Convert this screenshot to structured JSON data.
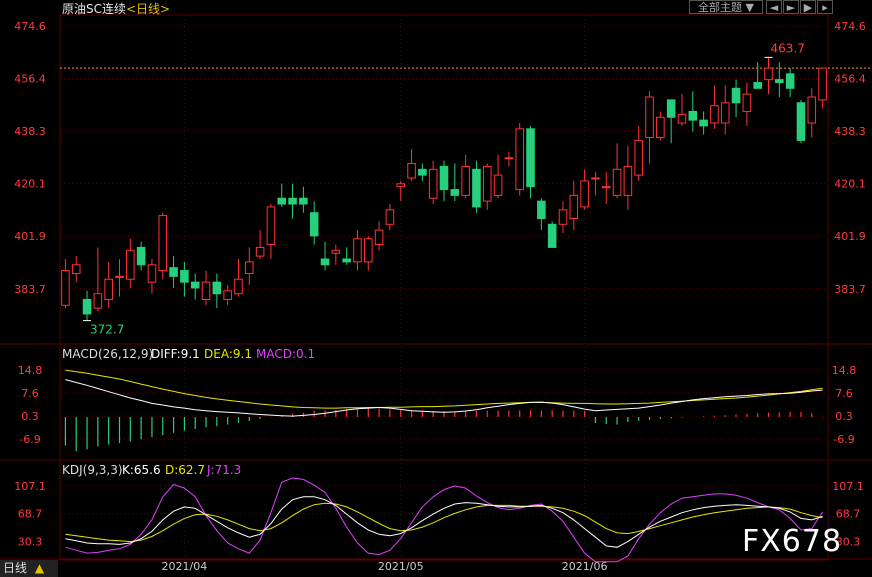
{
  "header": {
    "title": "原油SC连续",
    "period_link": "<日线>",
    "theme_button": "全部主题",
    "dropdown_icon": "triangle-down-icon",
    "nav_prev_icon": "step-left-icon",
    "nav_next_icon": "step-right-icon",
    "nav_end_icon": "triangle-right-icon"
  },
  "colors": {
    "up": "#ff3232",
    "down": "#26d07c",
    "diff": "#ffffff",
    "dea": "#e6e600",
    "macd_k": "#ffffff",
    "kdj_d": "#e6e600",
    "kdj_j": "#e040fb",
    "grid": "#5a0000"
  },
  "chart_data": [
    {
      "type": "candlestick",
      "ylim": [
        366,
        478
      ],
      "y_ticks": [
        "474.6",
        "456.4",
        "438.3",
        "420.1",
        "401.9",
        "383.7"
      ],
      "high_label": "463.7",
      "low_label": "372.7",
      "reference_line": 460,
      "candles": [
        [
          378,
          390,
          394,
          377
        ],
        [
          389,
          392,
          395,
          386
        ],
        [
          380,
          375,
          383,
          372.7
        ],
        [
          377,
          382,
          398,
          376
        ],
        [
          380,
          387,
          393,
          377
        ],
        [
          388,
          388,
          394,
          381
        ],
        [
          387,
          397,
          401,
          384
        ],
        [
          398,
          392,
          400,
          390
        ],
        [
          386,
          392,
          394,
          382
        ],
        [
          390,
          409,
          410,
          387
        ],
        [
          391,
          388,
          395,
          384
        ],
        [
          390,
          386,
          393,
          381
        ],
        [
          386,
          384,
          389,
          380
        ],
        [
          380,
          386,
          390,
          378
        ],
        [
          386,
          382,
          389,
          377
        ],
        [
          380,
          383,
          385,
          378
        ],
        [
          382,
          387,
          394,
          381
        ],
        [
          389,
          393,
          398,
          385
        ],
        [
          395,
          398,
          404,
          394
        ],
        [
          399,
          412,
          413,
          394
        ],
        [
          415,
          413,
          420,
          412
        ],
        [
          415,
          413,
          420,
          408
        ],
        [
          415,
          413,
          419,
          410
        ],
        [
          410,
          402,
          414,
          399
        ],
        [
          394,
          392,
          400,
          390
        ],
        [
          396,
          397,
          399,
          392
        ],
        [
          394,
          393,
          398,
          392
        ],
        [
          393,
          401,
          404,
          390
        ],
        [
          393,
          401,
          402,
          390
        ],
        [
          399,
          404,
          407,
          397
        ],
        [
          406,
          411,
          413,
          404
        ],
        [
          419,
          420,
          421,
          414
        ],
        [
          422,
          427,
          432,
          421
        ],
        [
          425,
          423,
          427,
          421
        ],
        [
          415,
          425,
          428,
          413
        ],
        [
          426,
          418,
          428,
          414
        ],
        [
          418,
          416,
          427,
          414
        ],
        [
          416,
          426,
          430,
          415
        ],
        [
          425,
          412,
          428,
          410
        ],
        [
          414,
          426,
          427,
          411
        ],
        [
          416,
          423,
          430,
          415
        ],
        [
          429,
          429,
          431,
          426
        ],
        [
          418,
          439,
          441,
          416
        ],
        [
          439,
          419,
          440,
          415
        ],
        [
          414,
          408,
          415,
          404
        ],
        [
          406,
          398,
          407,
          398
        ],
        [
          406,
          411,
          414,
          403
        ],
        [
          408,
          416,
          421,
          404
        ],
        [
          412,
          421,
          425,
          411
        ],
        [
          422,
          422,
          424,
          416
        ],
        [
          419,
          419,
          424,
          413
        ],
        [
          416,
          425,
          434,
          415
        ],
        [
          416,
          426,
          433,
          411
        ],
        [
          423,
          435,
          440,
          421
        ],
        [
          436,
          450,
          452,
          427
        ],
        [
          436,
          443,
          445,
          435
        ],
        [
          449,
          443,
          448,
          434
        ],
        [
          441,
          444,
          451,
          440
        ],
        [
          445,
          442,
          452,
          438
        ],
        [
          442,
          440,
          445,
          437
        ],
        [
          441,
          447,
          454,
          439
        ],
        [
          441,
          448,
          454,
          437
        ],
        [
          453,
          448,
          456,
          443
        ],
        [
          445,
          451,
          455,
          440
        ],
        [
          455,
          453,
          462,
          453
        ],
        [
          456,
          460,
          463.7,
          451
        ],
        [
          456,
          455,
          462,
          450
        ],
        [
          458,
          453,
          460,
          450
        ],
        [
          448,
          435,
          449,
          434
        ],
        [
          441,
          450,
          453,
          436
        ],
        [
          449,
          460,
          460,
          446
        ]
      ]
    },
    {
      "type": "line",
      "title": "MACD(26,12,9)",
      "diff": "DIFF:9.1",
      "dea": "DEA:9.1",
      "macd": "MACD:0.1",
      "ylim": [
        -12,
        18
      ],
      "y_ticks": [
        "14.8",
        "7.6",
        "0.3",
        "-6.9"
      ],
      "diff_values": [
        11.8,
        10.9,
        10.0,
        9.0,
        8.0,
        7.0,
        6.0,
        5.2,
        4.3,
        3.8,
        3.2,
        2.8,
        2.3,
        2.0,
        1.7,
        1.5,
        1.3,
        1.0,
        0.8,
        0.6,
        0.4,
        0.3,
        0.5,
        0.8,
        1.2,
        1.7,
        2.2,
        2.6,
        2.8,
        3.0,
        2.8,
        2.4,
        2.0,
        1.8,
        1.6,
        1.5,
        1.6,
        1.9,
        2.3,
        2.9,
        3.4,
        3.9,
        4.3,
        4.6,
        4.7,
        4.4,
        3.9,
        3.2,
        2.5,
        2.0,
        2.2,
        2.4,
        2.6,
        2.8,
        3.3,
        3.8,
        4.4,
        4.9,
        5.4,
        5.8,
        6.1,
        6.4,
        6.6,
        6.8,
        7.1,
        7.3,
        7.4,
        7.5,
        7.8,
        8.2,
        8.5
      ],
      "dea_values": [
        14.8,
        14.3,
        13.8,
        13.2,
        12.6,
        12.0,
        11.2,
        10.4,
        9.6,
        8.8,
        8.1,
        7.4,
        6.8,
        6.2,
        5.7,
        5.3,
        4.9,
        4.5,
        4.1,
        3.8,
        3.5,
        3.2,
        3.0,
        2.9,
        2.8,
        2.8,
        2.9,
        2.9,
        3.0,
        3.0,
        3.1,
        3.1,
        3.2,
        3.3,
        3.3,
        3.4,
        3.5,
        3.7,
        3.9,
        4.1,
        4.3,
        4.4,
        4.5,
        4.6,
        4.6,
        4.5,
        4.4,
        4.3,
        4.3,
        4.2,
        4.1,
        4.1,
        4.2,
        4.3,
        4.4,
        4.6,
        4.8,
        5.0,
        5.2,
        5.4,
        5.6,
        5.8,
        6.0,
        6.3,
        6.6,
        6.9,
        7.3,
        7.7,
        8.1,
        8.6,
        9.1
      ],
      "hist_values": [
        -9.0,
        -10.8,
        -10.2,
        -9.3,
        -8.7,
        -8.2,
        -7.7,
        -7.0,
        -6.4,
        -5.7,
        -5.0,
        -4.3,
        -3.8,
        -3.3,
        -2.9,
        -2.4,
        -1.8,
        -1.3,
        -0.6,
        -0.1,
        0.4,
        1.0,
        1.4,
        2.0,
        2.1,
        2.3,
        2.5,
        2.6,
        2.7,
        2.6,
        2.4,
        2.2,
        2.1,
        2.0,
        1.9,
        1.8,
        1.8,
        1.8,
        1.9,
        2.0,
        2.0,
        2.0,
        2.1,
        2.1,
        2.1,
        2.1,
        2.0,
        2.0,
        1.9,
        -1.9,
        -2.2,
        -2.4,
        -1.6,
        -1.2,
        -0.9,
        -0.6,
        -0.4,
        -0.2,
        0.0,
        0.2,
        0.4,
        0.6,
        0.8,
        1.0,
        1.2,
        1.4,
        1.5,
        1.7,
        1.6,
        1.2,
        0.1
      ]
    },
    {
      "type": "line",
      "title": "KDJ(9,3,3)",
      "k": "K:65.6",
      "d": "D:62.7",
      "j": "J:71.3",
      "ylim": [
        10,
        118
      ],
      "y_ticks": [
        "107.1",
        "68.7",
        "30.3"
      ],
      "k_values": [
        34,
        31,
        28,
        27,
        27,
        26,
        28,
        34,
        44,
        60,
        72,
        78,
        76,
        67,
        58,
        49,
        42,
        36,
        40,
        55,
        75,
        88,
        92,
        92,
        88,
        80,
        68,
        56,
        46,
        40,
        38,
        41,
        49,
        59,
        68,
        76,
        82,
        84,
        83,
        81,
        79,
        78,
        78,
        79,
        80,
        76,
        70,
        60,
        48,
        36,
        24,
        22,
        30,
        40,
        50,
        58,
        64,
        70,
        74,
        77,
        79,
        80,
        81,
        80,
        79,
        78,
        76,
        71,
        62,
        60,
        65
      ],
      "d_values": [
        40,
        38,
        36,
        34,
        32,
        31,
        30,
        32,
        37,
        45,
        54,
        62,
        67,
        68,
        65,
        60,
        54,
        48,
        45,
        48,
        56,
        66,
        75,
        81,
        83,
        82,
        78,
        71,
        63,
        55,
        48,
        45,
        46,
        50,
        56,
        63,
        69,
        74,
        78,
        80,
        80,
        80,
        79,
        79,
        79,
        78,
        76,
        72,
        66,
        57,
        48,
        42,
        41,
        44,
        48,
        52,
        56,
        60,
        64,
        67,
        70,
        72,
        74,
        76,
        77,
        78,
        77,
        75,
        70,
        66,
        63
      ],
      "j_values": [
        22,
        18,
        14,
        15,
        18,
        20,
        26,
        40,
        60,
        92,
        109,
        104,
        92,
        66,
        45,
        28,
        20,
        14,
        32,
        70,
        112,
        118,
        116,
        108,
        98,
        76,
        50,
        28,
        14,
        12,
        18,
        34,
        56,
        78,
        92,
        102,
        107,
        104,
        93,
        84,
        77,
        74,
        76,
        80,
        82,
        72,
        58,
        36,
        14,
        0,
        -4,
        -1,
        10,
        34,
        54,
        70,
        82,
        90,
        92,
        94,
        96,
        96,
        94,
        90,
        84,
        78,
        74,
        62,
        46,
        48,
        71
      ]
    }
  ],
  "x_axis": {
    "labels": [
      "2021/04",
      "2021/05",
      "2021/06"
    ],
    "label_index": [
      11,
      31,
      48
    ]
  },
  "footer": {
    "period": "日线",
    "period_icon": "triangle-up-icon"
  },
  "watermark": "FX678"
}
